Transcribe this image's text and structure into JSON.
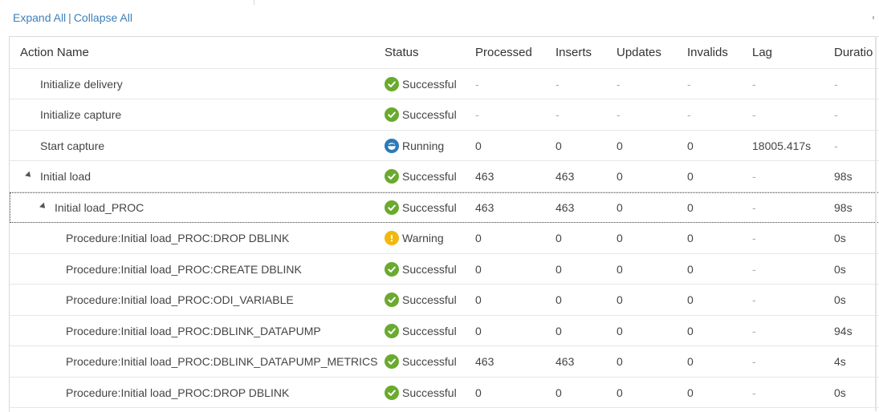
{
  "toolbar": {
    "expand_all": "Expand All",
    "separator": "|",
    "collapse_all": "Collapse All"
  },
  "columns": {
    "name": "Action Name",
    "status": "Status",
    "processed": "Processed",
    "inserts": "Inserts",
    "updates": "Updates",
    "invalids": "Invalids",
    "lag": "Lag",
    "duration": "Duratio"
  },
  "colors": {
    "successful": "#6aaa2f",
    "warning": "#f1b80d",
    "running": "#2c79b6",
    "link": "#3f7fb8"
  },
  "rows": [
    {
      "name": "Initialize delivery",
      "status": "Successful",
      "icon": "check-circle-icon",
      "processed": "-",
      "inserts": "-",
      "updates": "-",
      "invalids": "-",
      "lag": "-",
      "duration": "-"
    },
    {
      "name": "Initialize capture",
      "status": "Successful",
      "icon": "check-circle-icon",
      "processed": "-",
      "inserts": "-",
      "updates": "-",
      "invalids": "-",
      "lag": "-",
      "duration": "-"
    },
    {
      "name": "Start capture",
      "status": "Running",
      "icon": "running-icon",
      "processed": "0",
      "inserts": "0",
      "updates": "0",
      "invalids": "0",
      "lag": "18005.417s",
      "duration": "-"
    },
    {
      "name": "Initial load",
      "status": "Successful",
      "icon": "check-circle-icon",
      "expander": "expanded",
      "processed": "463",
      "inserts": "463",
      "updates": "0",
      "invalids": "0",
      "lag": "-",
      "duration": "98s"
    },
    {
      "name": "Initial load_PROC",
      "status": "Successful",
      "icon": "check-circle-icon",
      "expander": "expanded",
      "selected": true,
      "processed": "463",
      "inserts": "463",
      "updates": "0",
      "invalids": "0",
      "lag": "-",
      "duration": "98s"
    },
    {
      "name": "Procedure:Initial load_PROC:DROP DBLINK",
      "status": "Warning",
      "icon": "warning-icon",
      "processed": "0",
      "inserts": "0",
      "updates": "0",
      "invalids": "0",
      "lag": "-",
      "duration": "0s"
    },
    {
      "name": "Procedure:Initial load_PROC:CREATE DBLINK",
      "status": "Successful",
      "icon": "check-circle-icon",
      "processed": "0",
      "inserts": "0",
      "updates": "0",
      "invalids": "0",
      "lag": "-",
      "duration": "0s"
    },
    {
      "name": "Procedure:Initial load_PROC:ODI_VARIABLE",
      "status": "Successful",
      "icon": "check-circle-icon",
      "processed": "0",
      "inserts": "0",
      "updates": "0",
      "invalids": "0",
      "lag": "-",
      "duration": "0s"
    },
    {
      "name": "Procedure:Initial load_PROC:DBLINK_DATAPUMP",
      "status": "Successful",
      "icon": "check-circle-icon",
      "processed": "0",
      "inserts": "0",
      "updates": "0",
      "invalids": "0",
      "lag": "-",
      "duration": "94s"
    },
    {
      "name": "Procedure:Initial load_PROC:DBLINK_DATAPUMP_METRICS",
      "status": "Successful",
      "icon": "check-circle-icon",
      "processed": "463",
      "inserts": "463",
      "updates": "0",
      "invalids": "0",
      "lag": "-",
      "duration": "4s"
    },
    {
      "name": "Procedure:Initial load_PROC:DROP DBLINK",
      "status": "Successful",
      "icon": "check-circle-icon",
      "processed": "0",
      "inserts": "0",
      "updates": "0",
      "invalids": "0",
      "lag": "-",
      "duration": "0s"
    }
  ]
}
